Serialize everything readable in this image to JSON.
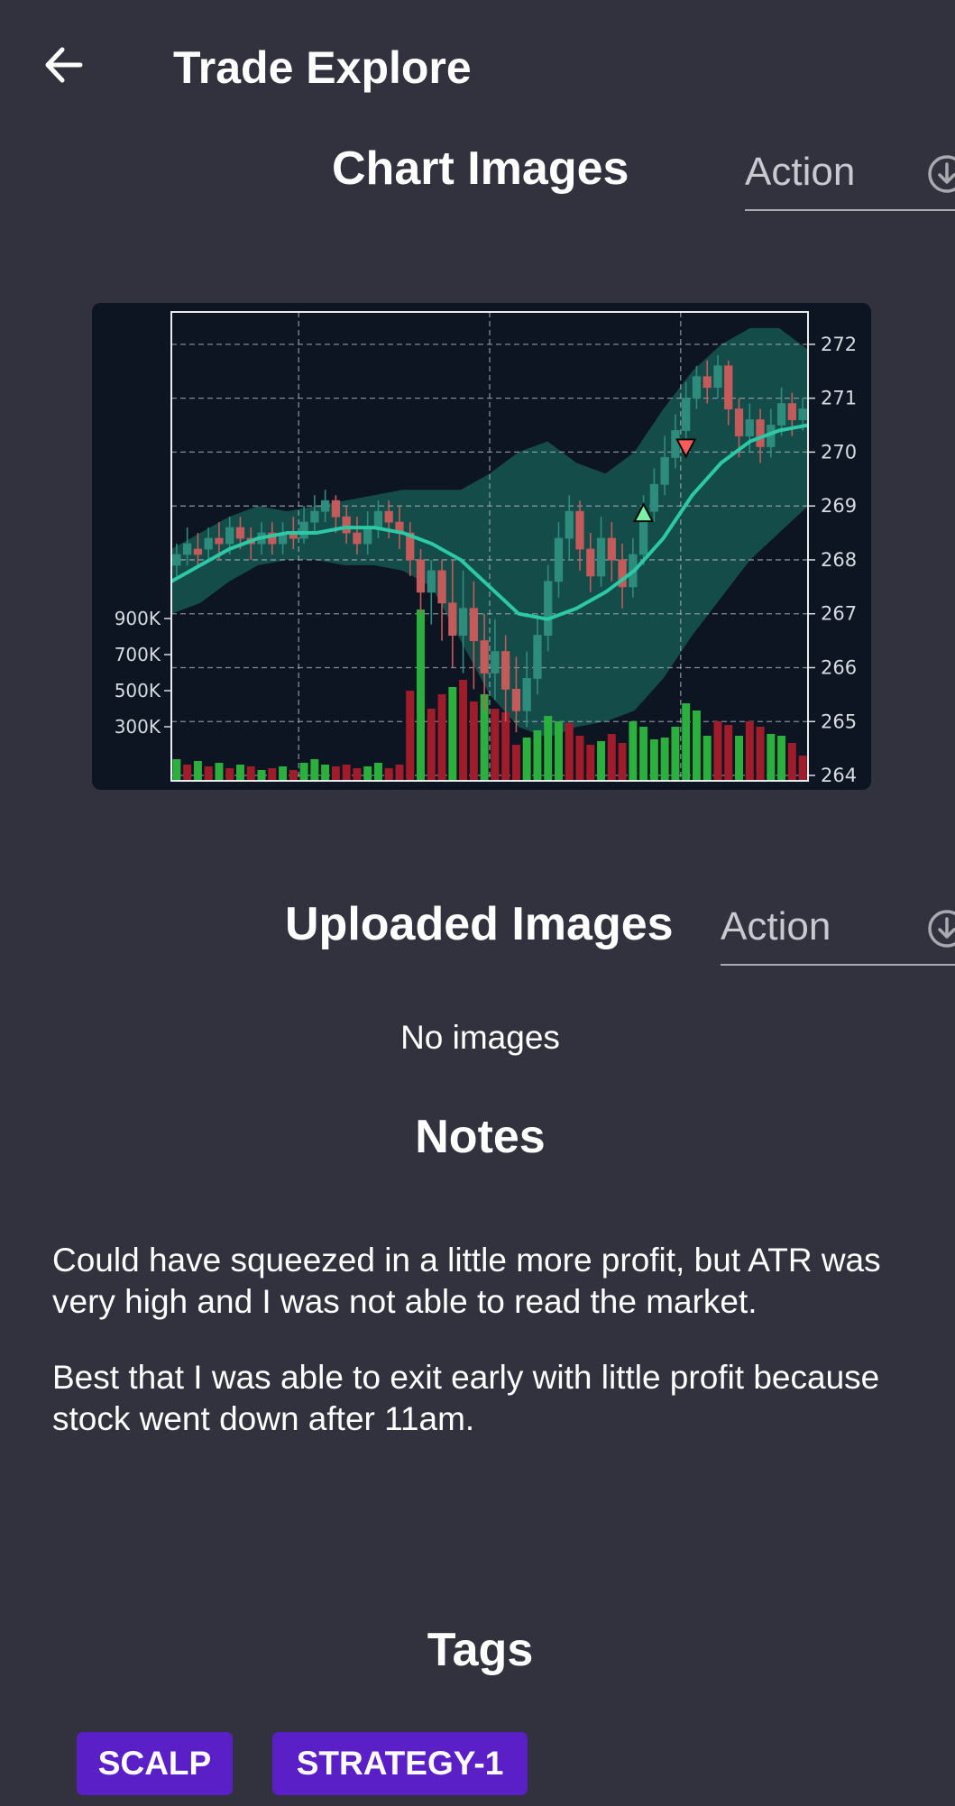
{
  "header": {
    "title": "Trade Explore",
    "back_icon": "arrow-left-icon"
  },
  "chart_section": {
    "heading": "Chart Images",
    "action_label": "Action",
    "action_icon": "download-circle-icon"
  },
  "chart_data": {
    "type": "candlestick",
    "title": "",
    "xlabel": "",
    "ylabel": "",
    "y_ticks_right": [
      "272",
      "271",
      "270",
      "269",
      "268",
      "267",
      "266",
      "265",
      "264"
    ],
    "volume_ticks_left": [
      "900K",
      "700K",
      "500K",
      "300K"
    ],
    "ylim": [
      263.9,
      272.6
    ],
    "volume_max": 1000000,
    "bollinger_band": {
      "upper": [
        268.2,
        268.5,
        268.8,
        269.0,
        268.9,
        269.0,
        269.1,
        269.2,
        269.3,
        269.3,
        269.3,
        269.6,
        270.0,
        270.2,
        269.8,
        269.6,
        270.0,
        270.8,
        271.5,
        272.0,
        272.3,
        272.3,
        271.9
      ],
      "lower": [
        267.0,
        267.2,
        267.6,
        267.9,
        268.0,
        268.0,
        267.9,
        267.9,
        267.8,
        267.5,
        266.5,
        265.5,
        264.9,
        264.7,
        264.9,
        265.0,
        265.2,
        265.8,
        266.6,
        267.3,
        268.0,
        268.5,
        269.0
      ]
    },
    "moving_average": [
      267.6,
      267.9,
      268.2,
      268.4,
      268.5,
      268.5,
      268.6,
      268.6,
      268.5,
      268.3,
      268.0,
      267.5,
      267.0,
      266.9,
      267.1,
      267.4,
      267.8,
      268.4,
      269.2,
      269.8,
      270.2,
      270.4,
      270.5
    ],
    "candles": [
      {
        "o": 267.9,
        "c": 268.1,
        "h": 268.3,
        "l": 267.7
      },
      {
        "o": 268.1,
        "c": 268.3,
        "h": 268.6,
        "l": 267.9
      },
      {
        "o": 268.2,
        "c": 268.1,
        "h": 268.5,
        "l": 267.9
      },
      {
        "o": 268.2,
        "c": 268.4,
        "h": 268.6,
        "l": 268.0
      },
      {
        "o": 268.4,
        "c": 268.3,
        "h": 268.7,
        "l": 268.0
      },
      {
        "o": 268.3,
        "c": 268.6,
        "h": 268.8,
        "l": 268.1
      },
      {
        "o": 268.6,
        "c": 268.4,
        "h": 268.8,
        "l": 268.2
      },
      {
        "o": 268.4,
        "c": 268.3,
        "h": 268.6,
        "l": 268.0
      },
      {
        "o": 268.3,
        "c": 268.5,
        "h": 268.7,
        "l": 268.1
      },
      {
        "o": 268.5,
        "c": 268.3,
        "h": 268.7,
        "l": 268.1
      },
      {
        "o": 268.3,
        "c": 268.5,
        "h": 268.7,
        "l": 268.1
      },
      {
        "o": 268.5,
        "c": 268.4,
        "h": 268.8,
        "l": 268.2
      },
      {
        "o": 268.4,
        "c": 268.7,
        "h": 269.0,
        "l": 268.3
      },
      {
        "o": 268.7,
        "c": 268.9,
        "h": 269.2,
        "l": 268.5
      },
      {
        "o": 268.9,
        "c": 269.1,
        "h": 269.3,
        "l": 268.7
      },
      {
        "o": 269.1,
        "c": 268.8,
        "h": 269.2,
        "l": 268.5
      },
      {
        "o": 268.8,
        "c": 268.5,
        "h": 269.0,
        "l": 268.3
      },
      {
        "o": 268.5,
        "c": 268.3,
        "h": 268.8,
        "l": 268.1
      },
      {
        "o": 268.3,
        "c": 268.6,
        "h": 268.9,
        "l": 268.1
      },
      {
        "o": 268.6,
        "c": 268.9,
        "h": 269.1,
        "l": 268.4
      },
      {
        "o": 268.9,
        "c": 268.7,
        "h": 269.1,
        "l": 268.4
      },
      {
        "o": 268.7,
        "c": 268.5,
        "h": 269.0,
        "l": 268.2
      },
      {
        "o": 268.5,
        "c": 268.0,
        "h": 268.7,
        "l": 267.7
      },
      {
        "o": 268.0,
        "c": 267.4,
        "h": 268.2,
        "l": 267.0
      },
      {
        "o": 267.4,
        "c": 267.8,
        "h": 268.0,
        "l": 266.8
      },
      {
        "o": 267.8,
        "c": 267.2,
        "h": 268.0,
        "l": 266.5
      },
      {
        "o": 267.2,
        "c": 266.6,
        "h": 268.0,
        "l": 266.0
      },
      {
        "o": 266.6,
        "c": 267.1,
        "h": 267.8,
        "l": 265.9
      },
      {
        "o": 267.1,
        "c": 266.5,
        "h": 267.6,
        "l": 265.6
      },
      {
        "o": 266.5,
        "c": 265.9,
        "h": 267.0,
        "l": 265.2
      },
      {
        "o": 265.9,
        "c": 266.3,
        "h": 266.9,
        "l": 265.4
      },
      {
        "o": 266.3,
        "c": 265.6,
        "h": 266.6,
        "l": 265.0
      },
      {
        "o": 265.6,
        "c": 265.2,
        "h": 266.2,
        "l": 264.8
      },
      {
        "o": 265.2,
        "c": 265.8,
        "h": 266.3,
        "l": 264.9
      },
      {
        "o": 265.8,
        "c": 266.6,
        "h": 267.0,
        "l": 265.5
      },
      {
        "o": 266.6,
        "c": 267.6,
        "h": 267.9,
        "l": 266.3
      },
      {
        "o": 267.6,
        "c": 268.4,
        "h": 268.7,
        "l": 267.3
      },
      {
        "o": 268.4,
        "c": 268.9,
        "h": 269.2,
        "l": 268.0
      },
      {
        "o": 268.9,
        "c": 268.2,
        "h": 269.1,
        "l": 267.8
      },
      {
        "o": 268.2,
        "c": 267.7,
        "h": 268.5,
        "l": 267.4
      },
      {
        "o": 267.7,
        "c": 268.4,
        "h": 268.8,
        "l": 267.5
      },
      {
        "o": 268.4,
        "c": 268.0,
        "h": 268.7,
        "l": 267.6
      },
      {
        "o": 268.0,
        "c": 267.5,
        "h": 268.3,
        "l": 267.1
      },
      {
        "o": 267.5,
        "c": 268.1,
        "h": 268.4,
        "l": 267.3
      },
      {
        "o": 268.1,
        "c": 268.9,
        "h": 269.2,
        "l": 267.9
      },
      {
        "o": 268.9,
        "c": 269.4,
        "h": 269.7,
        "l": 268.7
      },
      {
        "o": 269.4,
        "c": 269.9,
        "h": 270.3,
        "l": 269.2
      },
      {
        "o": 269.9,
        "c": 270.4,
        "h": 270.7,
        "l": 269.7
      },
      {
        "o": 270.4,
        "c": 271.0,
        "h": 271.3,
        "l": 270.2
      },
      {
        "o": 271.0,
        "c": 271.4,
        "h": 271.6,
        "l": 270.8
      },
      {
        "o": 271.4,
        "c": 271.2,
        "h": 271.7,
        "l": 270.9
      },
      {
        "o": 271.2,
        "c": 271.6,
        "h": 271.8,
        "l": 271.0
      },
      {
        "o": 271.6,
        "c": 270.8,
        "h": 271.7,
        "l": 270.5
      },
      {
        "o": 270.8,
        "c": 270.3,
        "h": 271.0,
        "l": 269.9
      },
      {
        "o": 270.3,
        "c": 270.6,
        "h": 270.9,
        "l": 270.0
      },
      {
        "o": 270.6,
        "c": 270.1,
        "h": 270.8,
        "l": 269.8
      },
      {
        "o": 270.1,
        "c": 270.5,
        "h": 270.8,
        "l": 269.9
      },
      {
        "o": 270.5,
        "c": 270.9,
        "h": 271.2,
        "l": 270.3
      },
      {
        "o": 270.9,
        "c": 270.6,
        "h": 271.1,
        "l": 270.3
      },
      {
        "o": 270.6,
        "c": 270.8,
        "h": 271.0,
        "l": 270.4
      }
    ],
    "volumes": [
      {
        "v": 120000,
        "up": true
      },
      {
        "v": 90000,
        "up": false
      },
      {
        "v": 110000,
        "up": true
      },
      {
        "v": 80000,
        "up": false
      },
      {
        "v": 100000,
        "up": true
      },
      {
        "v": 70000,
        "up": false
      },
      {
        "v": 90000,
        "up": true
      },
      {
        "v": 80000,
        "up": false
      },
      {
        "v": 60000,
        "up": true
      },
      {
        "v": 70000,
        "up": false
      },
      {
        "v": 80000,
        "up": true
      },
      {
        "v": 60000,
        "up": false
      },
      {
        "v": 100000,
        "up": true
      },
      {
        "v": 120000,
        "up": true
      },
      {
        "v": 90000,
        "up": true
      },
      {
        "v": 80000,
        "up": false
      },
      {
        "v": 90000,
        "up": false
      },
      {
        "v": 70000,
        "up": false
      },
      {
        "v": 80000,
        "up": true
      },
      {
        "v": 100000,
        "up": true
      },
      {
        "v": 70000,
        "up": false
      },
      {
        "v": 90000,
        "up": false
      },
      {
        "v": 500000,
        "up": false
      },
      {
        "v": 950000,
        "up": true
      },
      {
        "v": 400000,
        "up": false
      },
      {
        "v": 480000,
        "up": false
      },
      {
        "v": 520000,
        "up": true
      },
      {
        "v": 560000,
        "up": false
      },
      {
        "v": 440000,
        "up": false
      },
      {
        "v": 480000,
        "up": true
      },
      {
        "v": 400000,
        "up": false
      },
      {
        "v": 380000,
        "up": false
      },
      {
        "v": 200000,
        "up": false
      },
      {
        "v": 240000,
        "up": true
      },
      {
        "v": 280000,
        "up": true
      },
      {
        "v": 360000,
        "up": true
      },
      {
        "v": 330000,
        "up": true
      },
      {
        "v": 320000,
        "up": false
      },
      {
        "v": 250000,
        "up": false
      },
      {
        "v": 200000,
        "up": false
      },
      {
        "v": 220000,
        "up": true
      },
      {
        "v": 260000,
        "up": false
      },
      {
        "v": 210000,
        "up": false
      },
      {
        "v": 330000,
        "up": true
      },
      {
        "v": 300000,
        "up": true
      },
      {
        "v": 230000,
        "up": true
      },
      {
        "v": 240000,
        "up": true
      },
      {
        "v": 300000,
        "up": true
      },
      {
        "v": 430000,
        "up": true
      },
      {
        "v": 390000,
        "up": true
      },
      {
        "v": 250000,
        "up": true
      },
      {
        "v": 330000,
        "up": false
      },
      {
        "v": 310000,
        "up": false
      },
      {
        "v": 250000,
        "up": true
      },
      {
        "v": 330000,
        "up": false
      },
      {
        "v": 300000,
        "up": false
      },
      {
        "v": 260000,
        "up": true
      },
      {
        "v": 250000,
        "up": true
      },
      {
        "v": 210000,
        "up": false
      },
      {
        "v": 140000,
        "up": false
      }
    ],
    "markers": [
      {
        "type": "buy",
        "index": 44,
        "price": 268.85
      },
      {
        "type": "sell",
        "index": 48,
        "price": 270.1
      }
    ],
    "colors": {
      "background": "#0d1522",
      "band": "#1c7a6c",
      "moving_average": "#2cc9a6",
      "up": "#2e8c7c",
      "down": "#c45a5a",
      "volume_up": "#2bb03e",
      "volume_down": "#a01c2a",
      "grid": "#a0a8b0",
      "axis_text": "#d7dce2",
      "buy_marker": "#7cf0a6",
      "sell_marker": "#ff5b5b"
    }
  },
  "uploaded_section": {
    "heading": "Uploaded Images",
    "action_label": "Action",
    "action_icon": "download-circle-icon",
    "empty_text": "No images"
  },
  "notes_section": {
    "heading": "Notes",
    "paragraphs": [
      "Could have squeezed in a little more profit, but ATR was very high and I was not able to read the market.",
      "Best that I was able to exit early with little profit because stock went down after 11am."
    ]
  },
  "tags_section": {
    "heading": "Tags",
    "tags": [
      "SCALP",
      "STRATEGY-1"
    ],
    "tag_color": "#5a1fc7"
  }
}
